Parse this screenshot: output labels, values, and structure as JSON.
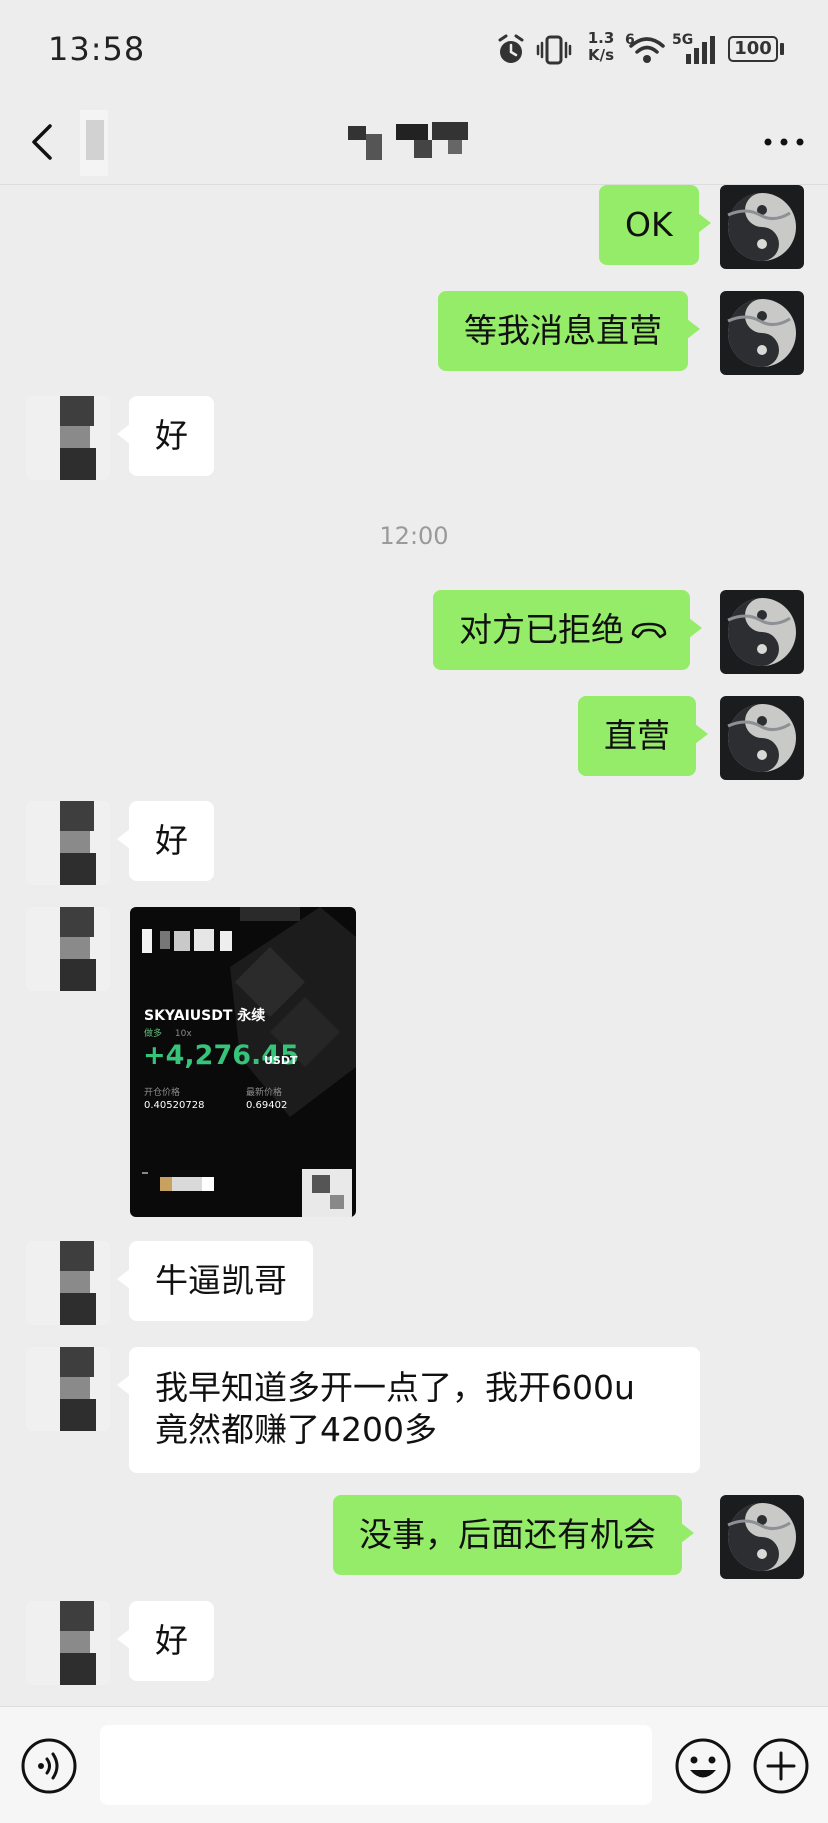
{
  "status_bar": {
    "time": "13:58",
    "net_speed_top": "1.3",
    "net_speed_bottom": "K/s",
    "wifi_badge": "6",
    "signal_badge": "5G",
    "battery": "100",
    "icons": [
      "alarm-icon",
      "vibrate-icon",
      "wifi-icon",
      "signal-icon",
      "battery-icon"
    ]
  },
  "nav": {
    "back_icon": "chevron-left-icon",
    "more_icon": "more-icon"
  },
  "messages": [
    {
      "from": "me",
      "text": "OK"
    },
    {
      "from": "me",
      "text": "等我消息直营"
    },
    {
      "from": "them",
      "text": "好"
    },
    {
      "timestamp": "12:00"
    },
    {
      "from": "me",
      "text": "对方已拒绝",
      "icon": "hangup-icon"
    },
    {
      "from": "me",
      "text": "直营"
    },
    {
      "from": "them",
      "text": "好"
    },
    {
      "from": "them",
      "type": "image"
    },
    {
      "from": "them",
      "text": "牛逼凯哥"
    },
    {
      "from": "them",
      "text_line1": "我早知道多开一点了，我开600u",
      "text_line2": "竟然都赚了4200多"
    },
    {
      "from": "me",
      "text": "没事，后面还有机会"
    },
    {
      "from": "them",
      "text": "好"
    }
  ],
  "card": {
    "pair": "SKYAIUSDT 永续",
    "side": "做多",
    "leverage": "10x",
    "pnl": "+4,276.45",
    "unit": "USDT",
    "open_label": "开仓价格",
    "open_value": "0.40520728",
    "last_label": "最新价格",
    "last_value": "0.69402"
  },
  "colors": {
    "background": "#ededed",
    "my_bubble": "#95ec69",
    "their_bubble": "#ffffff",
    "profit_green": "#35c47a"
  },
  "bottom_bar": {
    "voice_icon": "voice-icon",
    "emoji_icon": "emoji-icon",
    "plus_icon": "plus-icon"
  }
}
